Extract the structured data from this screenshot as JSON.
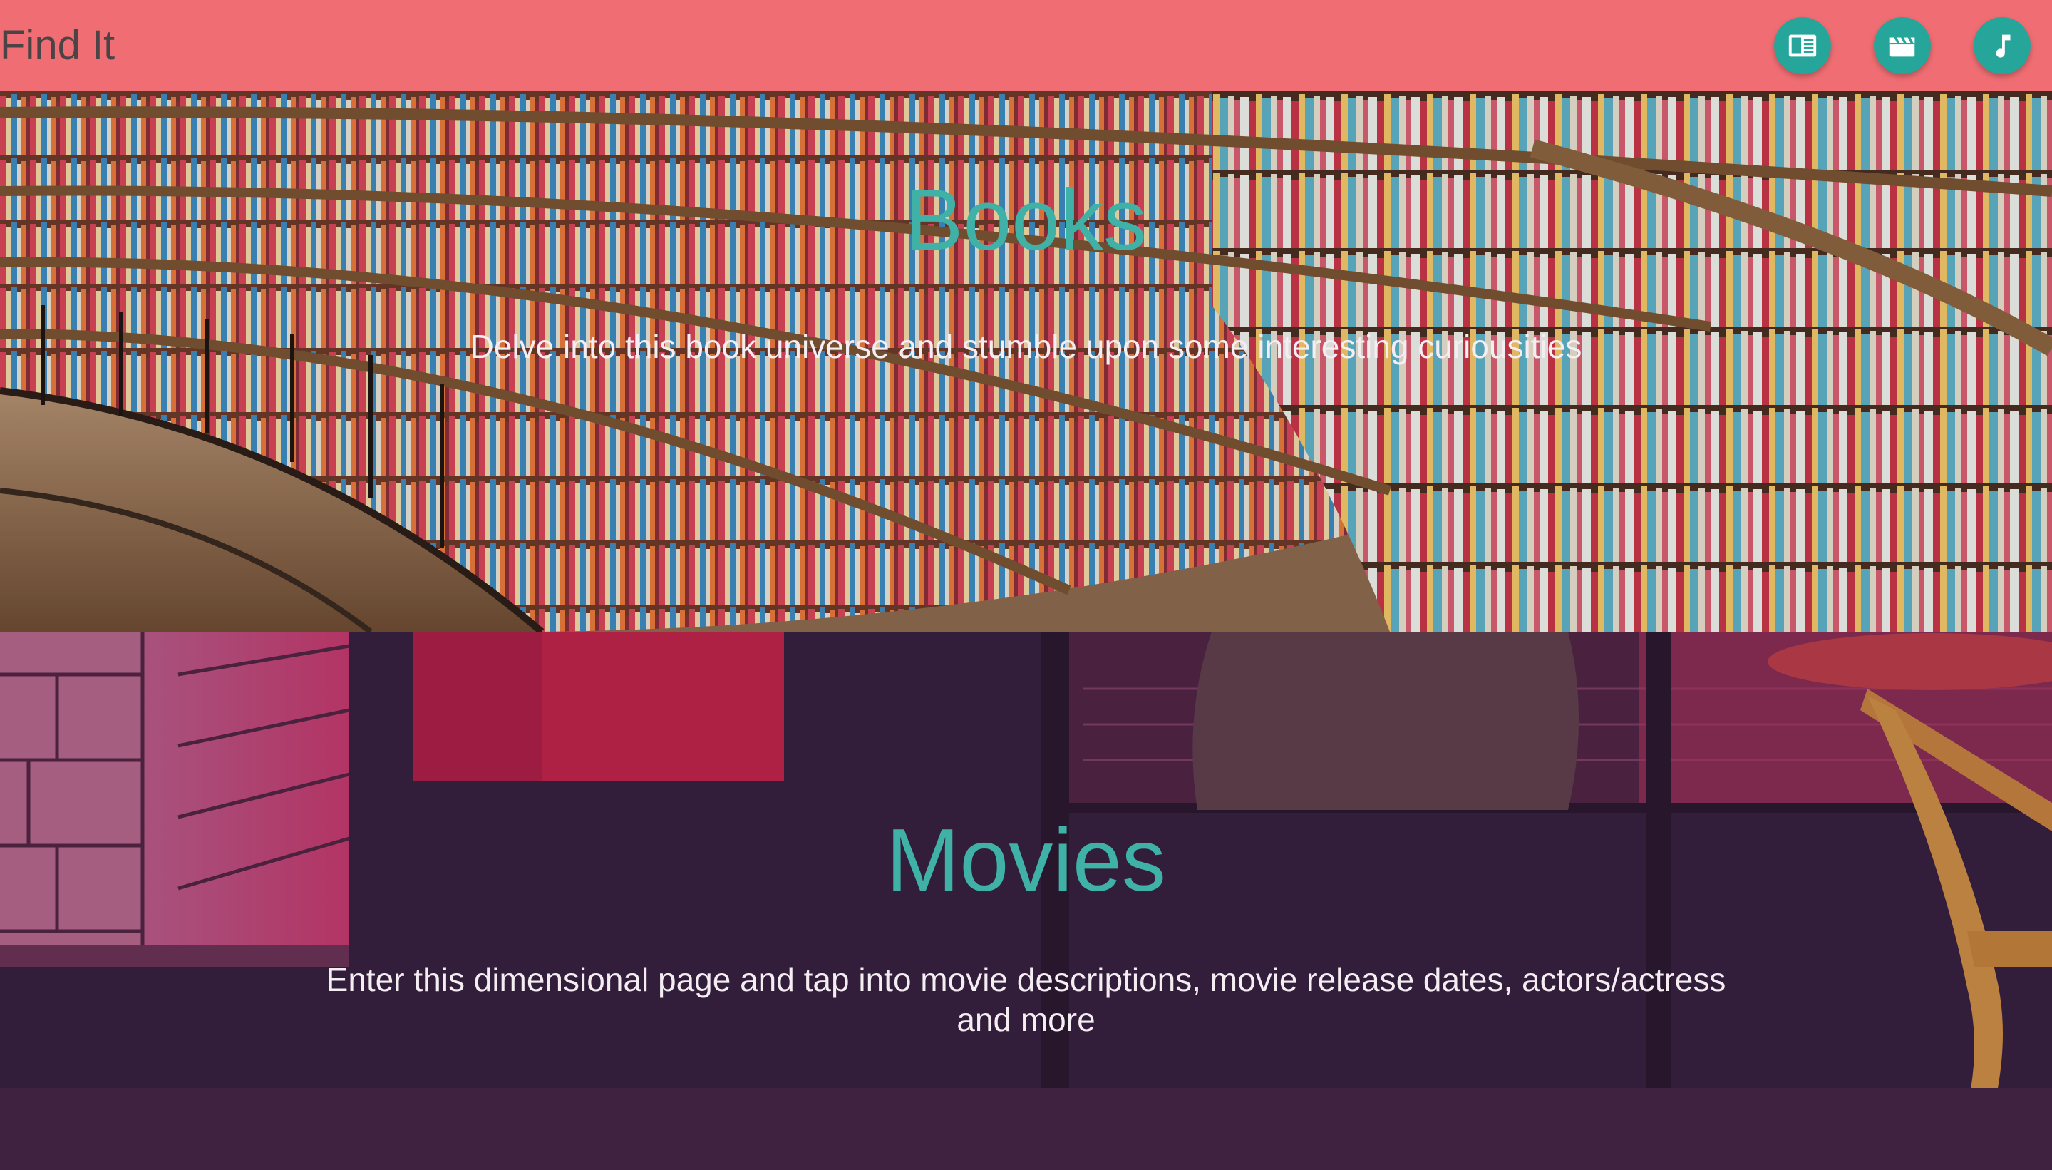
{
  "navbar": {
    "brand": "Find It",
    "buttons": [
      {
        "icon": "book-icon",
        "color": "#26a69a"
      },
      {
        "icon": "movie-clapper-icon",
        "color": "#26a69a"
      },
      {
        "icon": "music-note-icon",
        "color": "#26a69a"
      }
    ],
    "background": "#f06e73"
  },
  "books": {
    "title": "Books",
    "description": "Delve into this book universe and stumble upon some interesting curiousities",
    "background_image": "library bookshelves photo"
  },
  "movies": {
    "title": "Movies",
    "description": "Enter this dimensional page and tap into movie descriptions, movie release dates, actors/actress and more",
    "background_image": "purple-tinted cinema lounge photo"
  },
  "colors": {
    "accent": "#3fb1a6",
    "nav": "#f06e73",
    "fab": "#26a69a"
  }
}
